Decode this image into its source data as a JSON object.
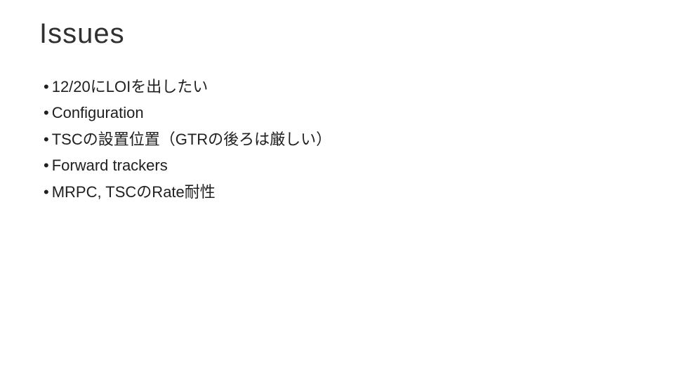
{
  "title": "Issues",
  "bullets": [
    "12/20にLOIを出したい",
    "Configuration",
    "TSCの設置位置（GTRの後ろは厳しい）",
    "Forward trackers",
    "MRPC, TSCのRate耐性"
  ]
}
